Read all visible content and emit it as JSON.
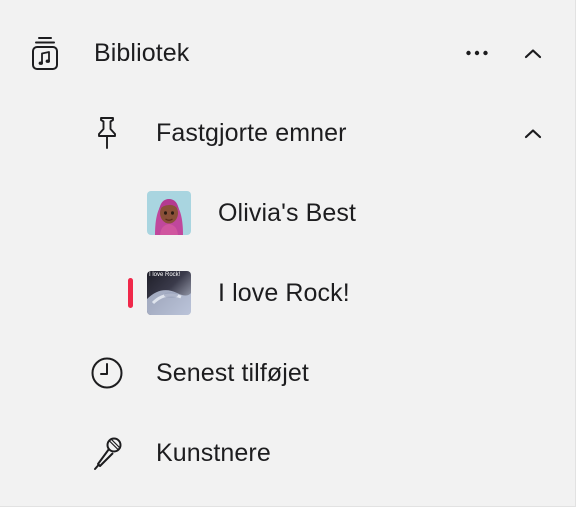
{
  "colors": {
    "background": "#f2f2f2",
    "text": "#1d1d1f",
    "accent": "#f0284a"
  },
  "library": {
    "label": "Bibliotek",
    "icon": "library-icon",
    "more_icon": "more-icon",
    "collapse_icon": "chevron-up-icon"
  },
  "pinned": {
    "label": "Fastgjorte emner",
    "icon": "pin-icon",
    "collapse_icon": "chevron-up-icon",
    "items": [
      {
        "label": "Olivia's Best",
        "artwork": "avatar-artwork",
        "selected": false
      },
      {
        "label": "I love Rock!",
        "artwork": "rock-album-artwork",
        "artwork_text": "I love Rock!",
        "selected": true
      }
    ]
  },
  "recent": {
    "label": "Senest tilføjet",
    "icon": "clock-icon"
  },
  "artists": {
    "label": "Kunstnere",
    "icon": "microphone-icon"
  }
}
